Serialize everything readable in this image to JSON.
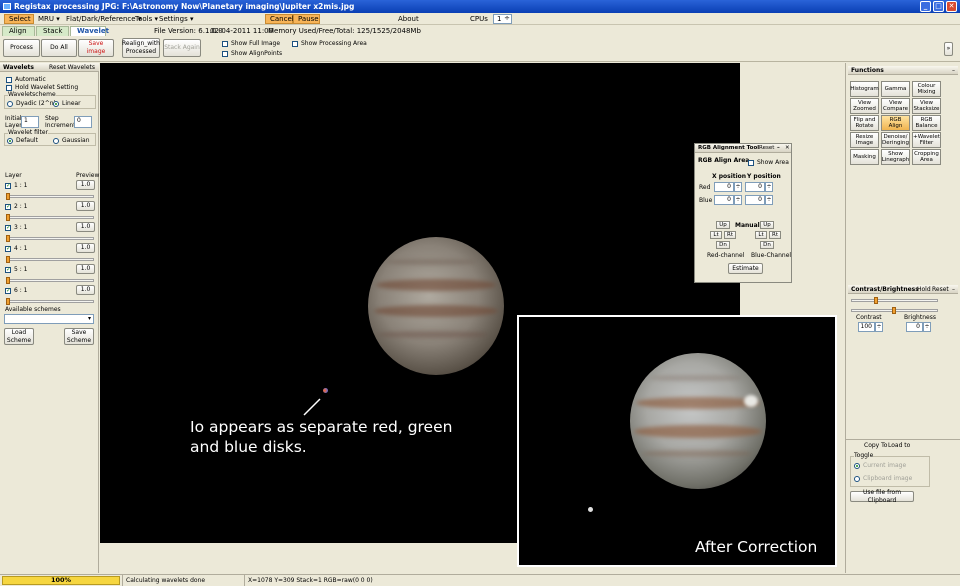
{
  "window": {
    "title": "Registax processing JPG: F:\\Astronomy Now\\Planetary imaging\\Jupiter x2mis.jpg"
  },
  "menu": {
    "select": "Select",
    "mru": "MRU",
    "flat": "Flat/Dark/Reference",
    "tools": "Tools",
    "settings": "Settings",
    "cancel": "Cancel",
    "pause": "Pause",
    "about": "About",
    "cpus_label": "CPUs",
    "cpus_value": "1"
  },
  "tabs": {
    "align": "Align",
    "stack": "Stack",
    "wavelet": "Wavelet"
  },
  "info": {
    "file_version": "File Version: 6.1.0.0",
    "date": "02-04-2011 11:00",
    "memory": "Memory Used/Free/Total: 125/1525/2048Mb"
  },
  "toolbar": {
    "process": "Process",
    "do_all": "Do All",
    "save_image": "Save image",
    "realign_1": "Realign_with",
    "realign_2": "Processed",
    "stack_again": "Stack Again",
    "show_full_image": "Show Full Image",
    "show_align_points": "Show AlignPoints",
    "show_processing_area": "Show Processing Area",
    "expand": "»"
  },
  "wavelets": {
    "title": "Wavelets",
    "reset": "Reset Wavelets",
    "automatic": "Automatic",
    "hold": "Hold Wavelet Setting",
    "scheme_label": "Waveletscheme",
    "dyadic": "Dyadic (2^n)",
    "linear": "Linear",
    "initial": "Initial",
    "layer_word": "Layer",
    "initial_value": "1",
    "step": "Step",
    "increment": "Increment",
    "step_value": "0",
    "filter_label": "Wavelet filter",
    "default": "Default",
    "gaussian": "Gaussian",
    "layer_col": "Layer",
    "preview_col": "Preview",
    "layers": [
      {
        "label": "1 : 1",
        "preview": "1.0"
      },
      {
        "label": "2 : 1",
        "preview": "1.0"
      },
      {
        "label": "3 : 1",
        "preview": "1.0"
      },
      {
        "label": "4 : 1",
        "preview": "1.0"
      },
      {
        "label": "5 : 1",
        "preview": "1.0"
      },
      {
        "label": "6 : 1",
        "preview": "1.0"
      }
    ],
    "available_schemes": "Available schemes",
    "load_1": "Load",
    "load_2": "Scheme",
    "save_1": "Save",
    "save_2": "Scheme"
  },
  "rgb_tool": {
    "title": "RGB Alignment Tool",
    "reset": "Reset",
    "min": "–",
    "close": "✕",
    "align_area": "RGB Align Area",
    "show_area": "Show Area",
    "x_position": "X position",
    "y_position": "Y position",
    "red": "Red",
    "blue": "Blue",
    "red_x": "0",
    "red_y": "0",
    "blue_x": "0",
    "blue_y": "0",
    "up": "Up",
    "lt": "Lt",
    "rt": "Rt",
    "dn": "Dn",
    "manual": "Manual",
    "red_channel": "Red-channel",
    "blue_channel": "Blue-Channel",
    "estimate": "Estimate"
  },
  "functions": {
    "title": "Functions",
    "buttons": [
      [
        "Histogram",
        ""
      ],
      [
        "Gamma",
        ""
      ],
      [
        "Colour",
        "Mixing"
      ],
      [
        "View",
        "Zoomed"
      ],
      [
        "View",
        "Compare"
      ],
      [
        "View",
        "Stacksize"
      ],
      [
        "Flip and",
        "Rotate"
      ],
      [
        "RGB",
        "Align"
      ],
      [
        "RGB",
        "Balance"
      ],
      [
        "Resize",
        "Image"
      ],
      [
        "Denoise/",
        "Deringing"
      ],
      [
        "+Wavelet",
        "Filter"
      ],
      [
        "Masking",
        ""
      ],
      [
        "Show",
        "Linegraph"
      ],
      [
        "Cropping",
        "Area"
      ]
    ]
  },
  "contrast": {
    "title": "Contrast/Brightness",
    "hold": "Hold",
    "reset": "Reset",
    "contrast_label": "Contrast",
    "contrast_value": "100",
    "brightness_label": "Brightness",
    "brightness_value": "0",
    "contrast_level": 0.28,
    "brightness_level": 0.5
  },
  "clipboard": {
    "copy_to": "Copy To",
    "load_to": "Load to",
    "toggle": "Toggle",
    "current": "Current image",
    "clipboard": "Clipboard image",
    "use_file": "Use file from Clipboard"
  },
  "annotations": {
    "io_line1": "Io appears as separate red, green",
    "io_line2": "and blue disks.",
    "after": "After Correction"
  },
  "status": {
    "progress": "100%",
    "message": "Calculating wavelets done",
    "coords": "X=1078 Y=309 Stack=1 RGB=raw(0 0 0)"
  }
}
